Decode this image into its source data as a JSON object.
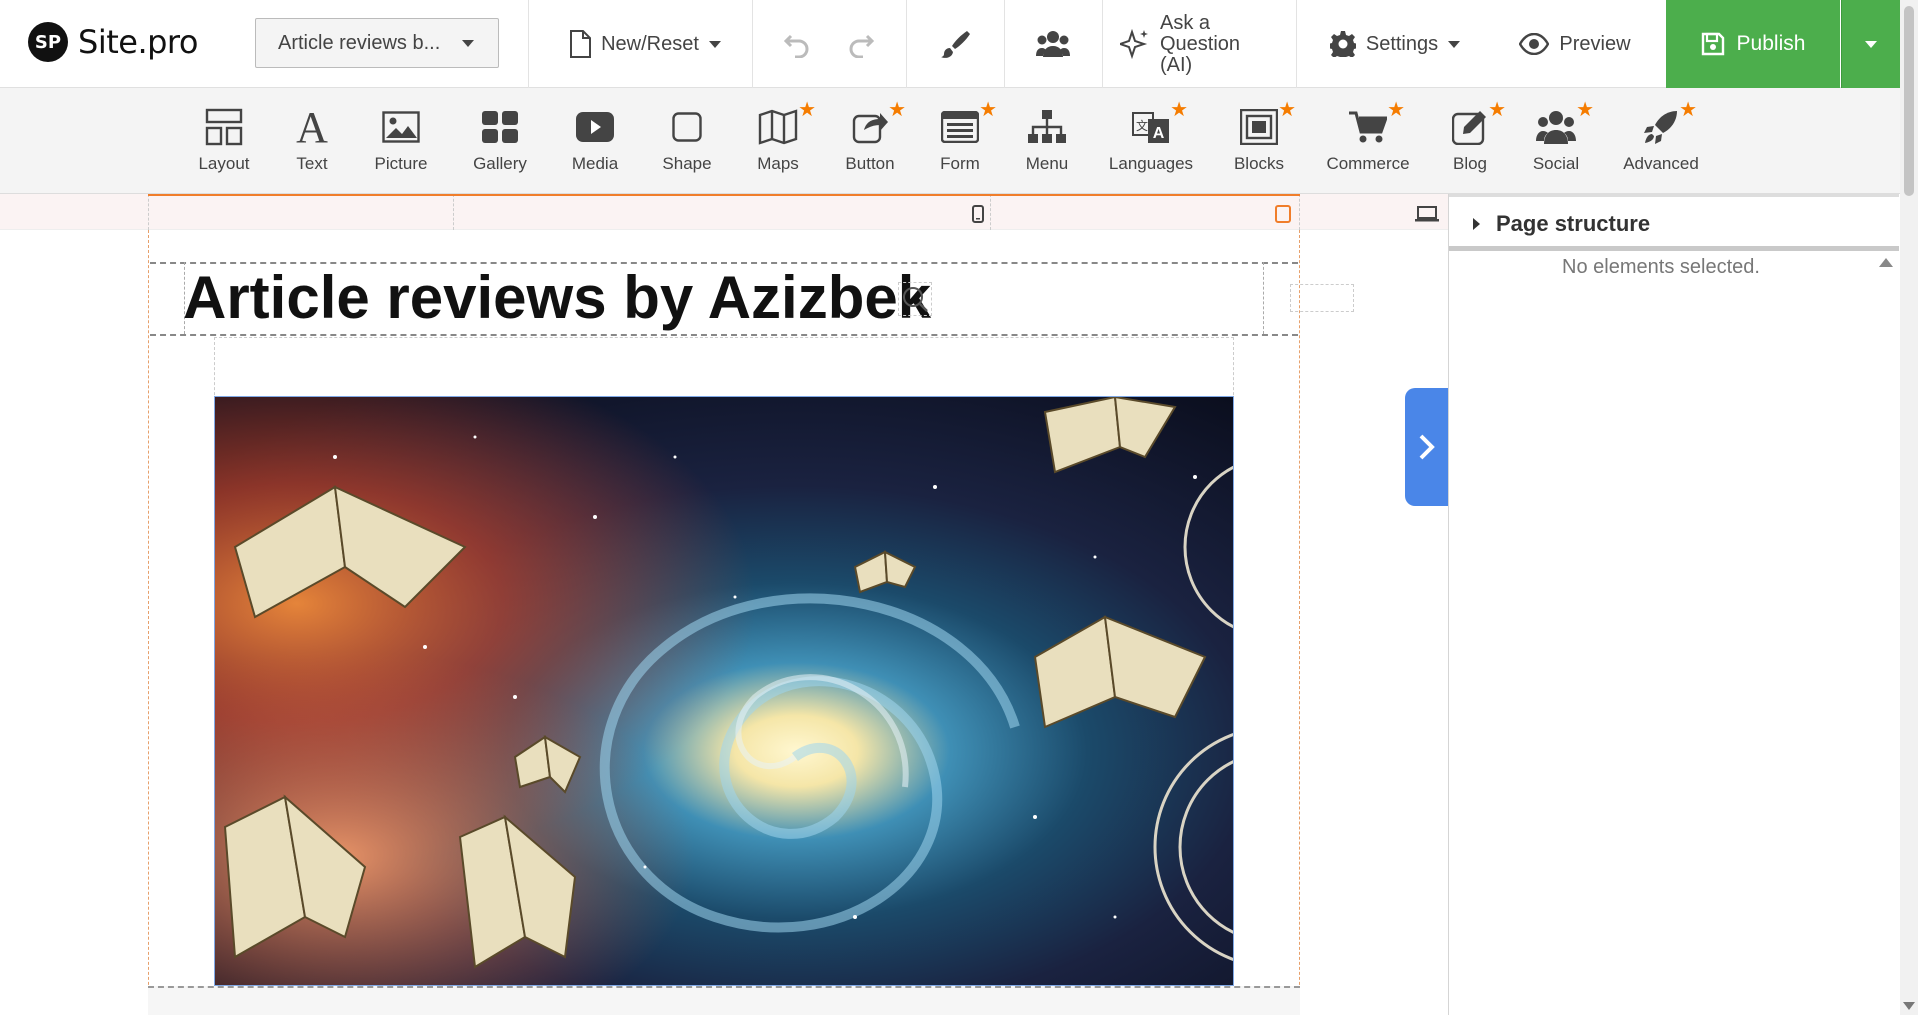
{
  "brand": {
    "logo_mark": "SP",
    "name": "Site.pro"
  },
  "topbar": {
    "page_selector": "Article reviews b...",
    "new_reset": "New/Reset",
    "ask_ai": "Ask a Question (AI)",
    "settings": "Settings",
    "preview": "Preview",
    "publish": "Publish"
  },
  "toolbar": {
    "items": [
      {
        "label": "Layout",
        "icon": "layout-icon",
        "premium": false
      },
      {
        "label": "Text",
        "icon": "text-icon",
        "premium": false
      },
      {
        "label": "Picture",
        "icon": "picture-icon",
        "premium": false
      },
      {
        "label": "Gallery",
        "icon": "gallery-icon",
        "premium": false
      },
      {
        "label": "Media",
        "icon": "media-icon",
        "premium": false
      },
      {
        "label": "Shape",
        "icon": "shape-icon",
        "premium": false
      },
      {
        "label": "Maps",
        "icon": "map-icon",
        "premium": true
      },
      {
        "label": "Button",
        "icon": "button-icon",
        "premium": true
      },
      {
        "label": "Form",
        "icon": "form-icon",
        "premium": true
      },
      {
        "label": "Menu",
        "icon": "menu-icon",
        "premium": false
      },
      {
        "label": "Languages",
        "icon": "languages-icon",
        "premium": true
      },
      {
        "label": "Blocks",
        "icon": "blocks-icon",
        "premium": true
      },
      {
        "label": "Commerce",
        "icon": "cart-icon",
        "premium": true
      },
      {
        "label": "Blog",
        "icon": "blog-icon",
        "premium": true
      },
      {
        "label": "Social",
        "icon": "social-icon",
        "premium": true
      },
      {
        "label": "Advanced",
        "icon": "rocket-icon",
        "premium": true
      }
    ]
  },
  "canvas": {
    "page_title": "Article reviews by Azizbek"
  },
  "sidebar": {
    "heading": "Page structure",
    "empty_message": "No elements selected."
  },
  "colors": {
    "publish": "#4cae4c",
    "accent_blue": "#4a86e8",
    "accent_orange": "#f07d2a",
    "premium_star": "#f57c00"
  }
}
